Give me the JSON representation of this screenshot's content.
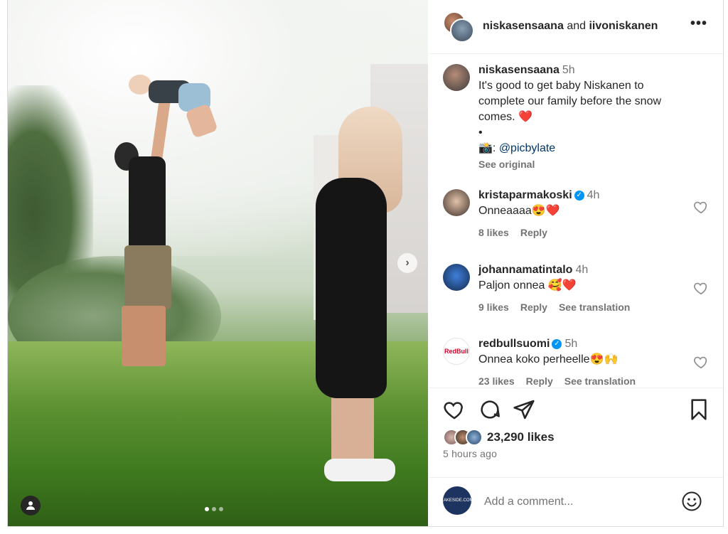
{
  "post": {
    "author": "niskasensaana",
    "coauthor": "iivoniskanen",
    "joiner": "and",
    "more_label": "•••",
    "carousel": {
      "current": 1,
      "total": 3
    }
  },
  "caption": {
    "username": "niskasensaana",
    "time": "5h",
    "text": "It's good to get baby Niskanen to complete our family before the snow comes. ❤️",
    "bullet": "•",
    "credit_prefix": "📸: ",
    "credit_mention": "@picbylate",
    "see_original": "See original"
  },
  "comments": [
    {
      "username": "kristaparmakoski",
      "verified": true,
      "time": "4h",
      "text": "Onneaaaa😍❤️",
      "likes": "8 likes",
      "reply": "Reply",
      "translate": ""
    },
    {
      "username": "johannamatintalo",
      "verified": false,
      "time": "4h",
      "text": "Paljon onnea 🥰❤️",
      "likes": "9 likes",
      "reply": "Reply",
      "translate": "See translation"
    },
    {
      "username": "redbullsuomi",
      "verified": true,
      "time": "5h",
      "text": "Onnea koko perheelle😍🙌",
      "likes": "23 likes",
      "reply": "Reply",
      "translate": "See translation",
      "avatar_text": "RedBull"
    }
  ],
  "stats": {
    "likes": "23,290 likes",
    "posted": "5 hours ago"
  },
  "composer": {
    "placeholder": "Add a comment...",
    "avatar_text": "LAKESIDE.COM"
  },
  "colors": {
    "text": "#262626",
    "secondary": "#737373",
    "verified": "#0095f6",
    "heart_red": "#ed4956",
    "link": "#00376b"
  }
}
